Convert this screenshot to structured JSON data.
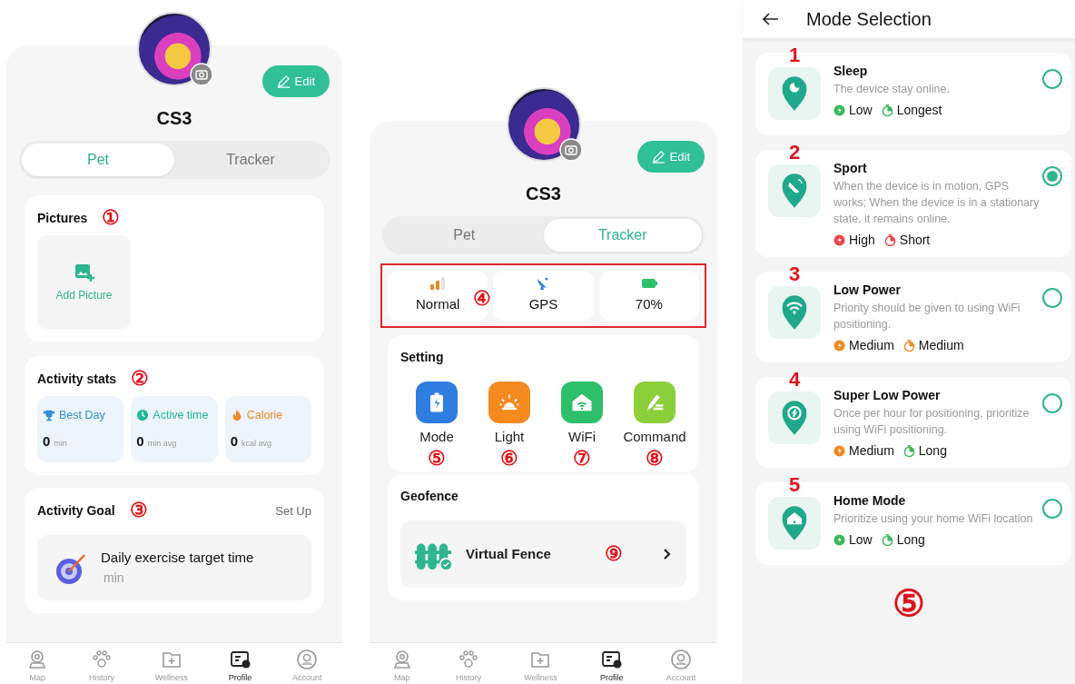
{
  "pet_profile": {
    "name": "CS3",
    "edit_button": "Edit",
    "tabs": [
      {
        "label": "Pet",
        "selected": true
      },
      {
        "label": "Tracker",
        "selected": false
      }
    ],
    "pictures": {
      "title": "Pictures",
      "marker": "①",
      "add_label": "Add Picture"
    },
    "activity_stats": {
      "title": "Activity stats",
      "marker": "②",
      "items": [
        {
          "kind": "trophy",
          "label": "Best Day",
          "value": "0",
          "unit": "min",
          "color": "#2f8fd8"
        },
        {
          "kind": "clock",
          "label": "Active time",
          "value": "0",
          "unit": "min avg",
          "color": "#1fb89a"
        },
        {
          "kind": "flame",
          "label": "Calorie",
          "value": "0",
          "unit": "kcal avg",
          "color": "#f0892a"
        }
      ]
    },
    "activity_goal": {
      "title": "Activity Goal",
      "marker": "③",
      "action": "Set Up",
      "goal_text": "Daily exercise target time",
      "goal_unit": "min"
    },
    "nav": [
      {
        "kind": "map",
        "label": "Map",
        "selected": false
      },
      {
        "kind": "paw",
        "label": "History",
        "selected": false
      },
      {
        "kind": "folder",
        "label": "Wellness",
        "selected": false
      },
      {
        "kind": "profile",
        "label": "Profile",
        "selected": true
      },
      {
        "kind": "account",
        "label": "Account",
        "selected": false
      }
    ]
  },
  "tracker_profile": {
    "name": "CS3",
    "edit_button": "Edit",
    "tabs": [
      {
        "label": "Pet",
        "selected": false
      },
      {
        "label": "Tracker",
        "selected": true
      }
    ],
    "status": {
      "marker": "④",
      "items": [
        {
          "kind": "signal",
          "label": "Normal"
        },
        {
          "kind": "satellite",
          "label": "GPS"
        },
        {
          "kind": "battery",
          "label": "70%"
        }
      ]
    },
    "setting": {
      "title": "Setting",
      "items": [
        {
          "kind": "mode",
          "label": "Mode",
          "marker": "⑤",
          "color": "#2f7de1"
        },
        {
          "kind": "light",
          "label": "Light",
          "marker": "⑥",
          "color": "#f58a1f"
        },
        {
          "kind": "wifi",
          "label": "WiFi",
          "marker": "⑦",
          "color": "#2dbf6a"
        },
        {
          "kind": "command",
          "label": "Command",
          "marker": "⑧",
          "color": "#8ccf3a"
        }
      ]
    },
    "geofence": {
      "title": "Geofence",
      "item": "Virtual Fence",
      "marker": "⑨"
    },
    "nav": [
      {
        "kind": "map",
        "label": "Map",
        "selected": false
      },
      {
        "kind": "paw",
        "label": "History",
        "selected": false
      },
      {
        "kind": "folder",
        "label": "Wellness",
        "selected": false
      },
      {
        "kind": "profile",
        "label": "Profile",
        "selected": true
      },
      {
        "kind": "account",
        "label": "Account",
        "selected": false
      }
    ]
  },
  "mode_selection": {
    "title": "Mode Selection",
    "marker": "⑤",
    "modes": [
      {
        "number": "1",
        "kind": "sleep",
        "title": "Sleep",
        "description": "The device stay online.",
        "tags": [
          {
            "kind": "power",
            "label": "Low",
            "color": "#3cb85a"
          },
          {
            "kind": "duration",
            "label": "Longest",
            "color": "#3cb85a"
          }
        ],
        "selected": false
      },
      {
        "number": "2",
        "kind": "sport",
        "title": "Sport",
        "description": "When the device is in motion, GPS works; When the device is in a stationary state, it remains online.",
        "tags": [
          {
            "kind": "power",
            "label": "High",
            "color": "#e8484a"
          },
          {
            "kind": "duration",
            "label": "Short",
            "color": "#e8484a"
          }
        ],
        "selected": true
      },
      {
        "number": "3",
        "kind": "wifi",
        "title": "Low Power",
        "description": "Priority should be given to using WiFi positioning.",
        "tags": [
          {
            "kind": "power",
            "label": "Medium",
            "color": "#f08a24"
          },
          {
            "kind": "duration",
            "label": "Medium",
            "color": "#f08a24"
          }
        ],
        "selected": false
      },
      {
        "number": "4",
        "kind": "super",
        "title": "Super Low Power",
        "description": "Once per hour for positioning, prioritize using WiFi positioning.",
        "tags": [
          {
            "kind": "power",
            "label": "Medium",
            "color": "#f08a24"
          },
          {
            "kind": "duration",
            "label": "Long",
            "color": "#3cb85a"
          }
        ],
        "selected": false
      },
      {
        "number": "5",
        "kind": "home",
        "title": "Home Mode",
        "description": "Prioritize using your home WiFi location",
        "tags": [
          {
            "kind": "power",
            "label": "Low",
            "color": "#3cb85a"
          },
          {
            "kind": "duration",
            "label": "Long",
            "color": "#3cb85a"
          }
        ],
        "selected": false
      }
    ]
  }
}
